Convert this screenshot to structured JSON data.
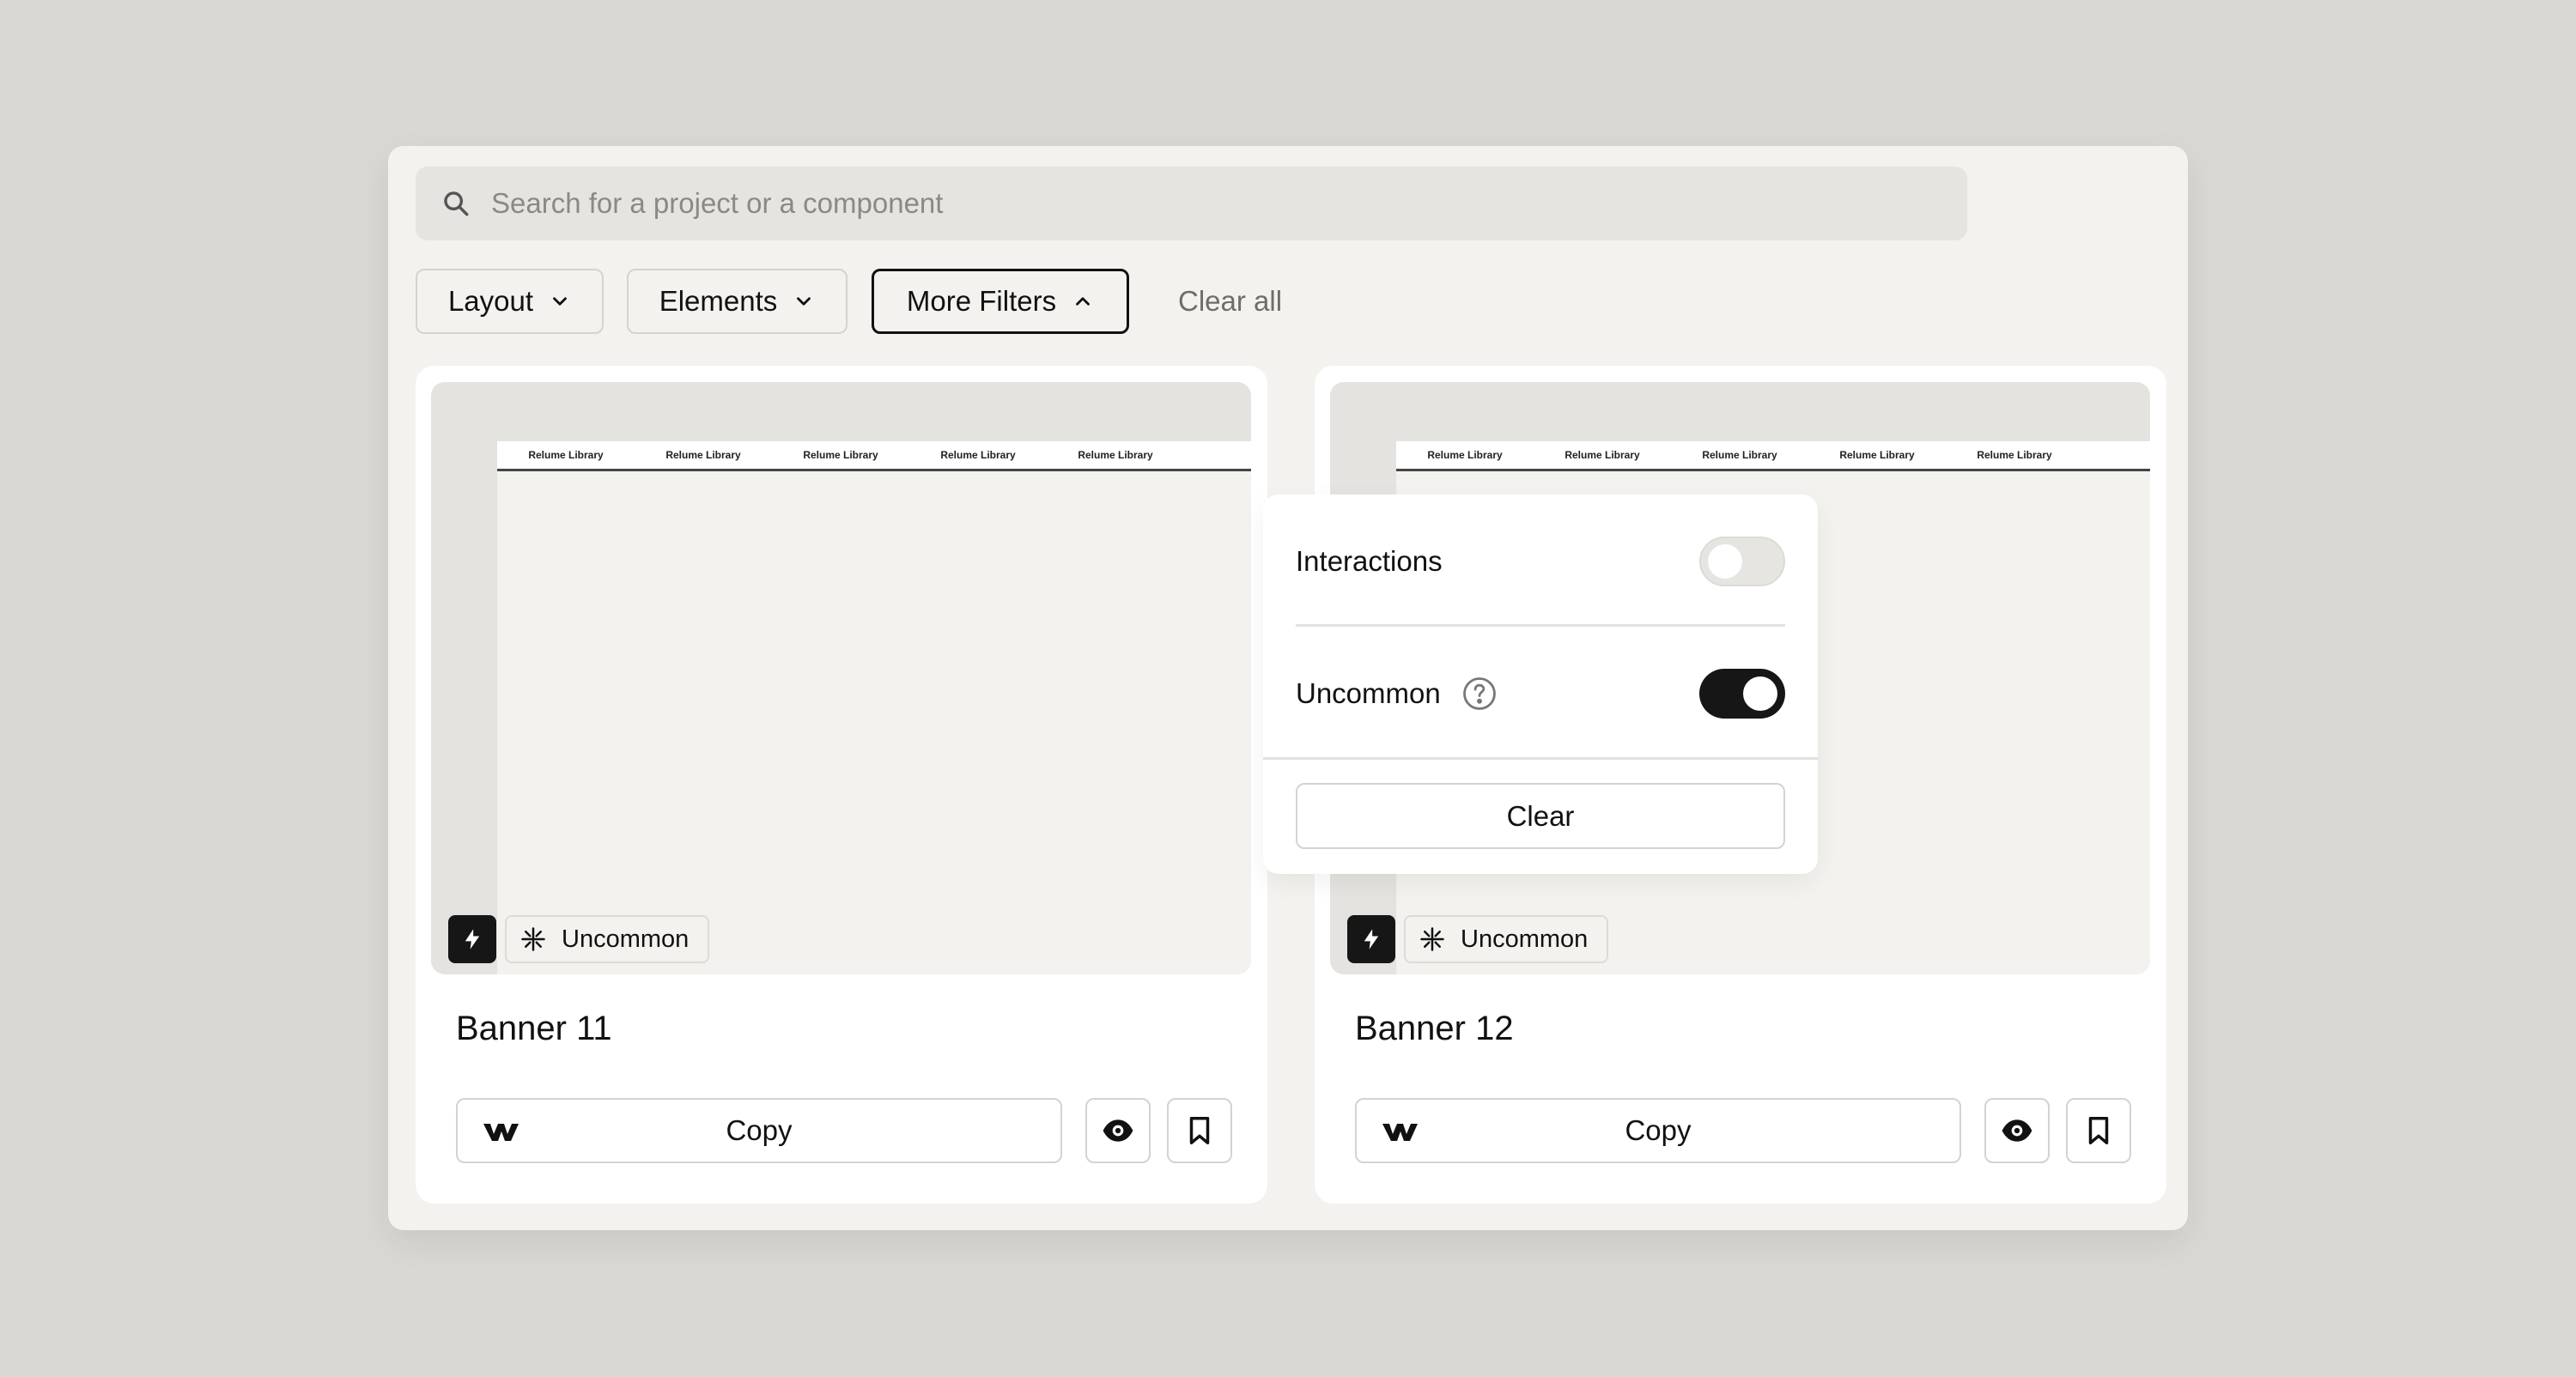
{
  "search": {
    "placeholder": "Search for a project or a component"
  },
  "filters": {
    "layout_label": "Layout",
    "elements_label": "Elements",
    "more_filters_label": "More Filters",
    "clear_all_label": "Clear all"
  },
  "dropdown": {
    "interactions_label": "Interactions",
    "interactions_on": false,
    "uncommon_label": "Uncommon",
    "uncommon_on": true,
    "clear_label": "Clear"
  },
  "cards": [
    {
      "title": "Banner 11",
      "tag": "Uncommon",
      "copy_label": "Copy",
      "preview_nav": [
        "Relume Library",
        "Relume Library",
        "Relume Library",
        "Relume Library",
        "Relume Library"
      ]
    },
    {
      "title": "Banner 12",
      "tag": "Uncommon",
      "copy_label": "Copy",
      "preview_nav": [
        "Relume Library",
        "Relume Library",
        "Relume Library",
        "Relume Library",
        "Relume Library"
      ]
    }
  ],
  "colors": {
    "background": "#d9d8d4",
    "panel": "#f3f2ef",
    "accent_dark": "#161616"
  }
}
